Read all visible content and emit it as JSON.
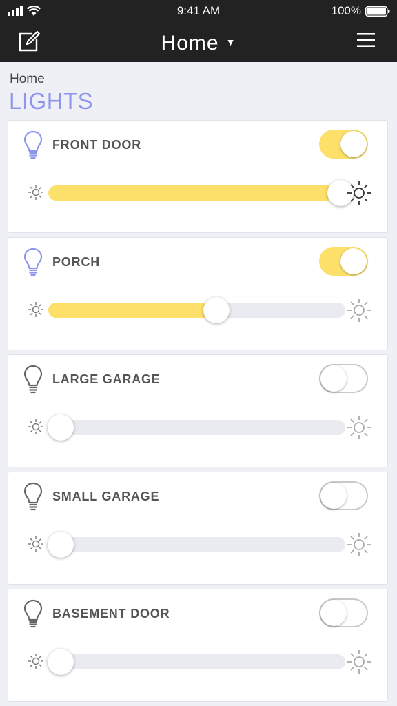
{
  "status_bar": {
    "time": "9:41 AM",
    "battery": "100%"
  },
  "nav": {
    "title": "Home",
    "caret": "▼"
  },
  "breadcrumb": "Home",
  "page_title": "LIGHTS",
  "colors": {
    "accent": "#8d95ec",
    "active": "#fce06a",
    "bar": "#222222"
  },
  "lights": [
    {
      "name": "FRONT DOOR",
      "on": true,
      "brightness": 1.0
    },
    {
      "name": "PORCH",
      "on": true,
      "brightness": 0.57
    },
    {
      "name": "LARGE GARAGE",
      "on": false,
      "brightness": 0.0
    },
    {
      "name": "SMALL GARAGE",
      "on": false,
      "brightness": 0.0
    },
    {
      "name": "BASEMENT DOOR",
      "on": false,
      "brightness": 0.0
    }
  ]
}
